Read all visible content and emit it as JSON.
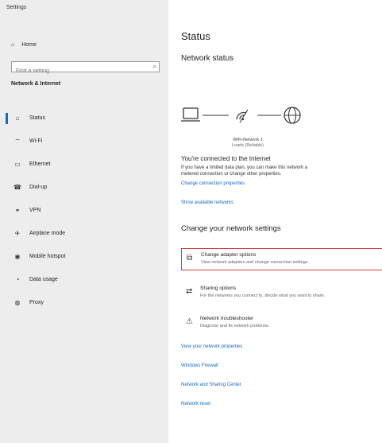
{
  "window": {
    "title": "Settings"
  },
  "sidebar": {
    "home_label": "Home",
    "search_placeholder": "Find a setting",
    "section_title": "Network & Internet",
    "items": [
      {
        "label": "Status",
        "icon": "home-icon",
        "active": true
      },
      {
        "label": "Wi-Fi",
        "icon": "wifi-icon"
      },
      {
        "label": "Ethernet",
        "icon": "ethernet-icon"
      },
      {
        "label": "Dial-up",
        "icon": "phone-icon"
      },
      {
        "label": "VPN",
        "icon": "vpn-icon"
      },
      {
        "label": "Airplane mode",
        "icon": "airplane-icon"
      },
      {
        "label": "Mobile hotspot",
        "icon": "hotspot-icon"
      },
      {
        "label": "Data usage",
        "icon": "data-usage-icon"
      },
      {
        "label": "Proxy",
        "icon": "globe-icon"
      }
    ]
  },
  "main": {
    "title": "Status",
    "network_status_heading": "Network status",
    "network": {
      "name": "WiFi-Network 1",
      "subtitle": "Loads (Reliable)"
    },
    "connected_title": "You're connected to the Internet",
    "connected_desc_line1": "If you have a limited data plan, you can make this network a",
    "connected_desc_line2": "metered connection or change other properties.",
    "link_change_connection": "Change connection properties",
    "link_show_networks": "Show available networks",
    "change_settings_heading": "Change your network settings",
    "settings": [
      {
        "title": "Change adapter options",
        "desc": "View network adapters and change connection settings.",
        "icon": "adapter-icon"
      },
      {
        "title": "Sharing options",
        "desc": "For the networks you connect to, decide what you want to share.",
        "icon": "sharing-icon"
      },
      {
        "title": "Network troubleshooter",
        "desc": "Diagnose and fix network problems.",
        "icon": "warning-icon"
      }
    ],
    "links": [
      "View your network properties",
      "Windows Firewall",
      "Network and Sharing Center",
      "Network reset"
    ]
  },
  "colors": {
    "accent": "#1569c7",
    "highlight": "#d23a3a",
    "sidebar_bg": "#ededed"
  }
}
